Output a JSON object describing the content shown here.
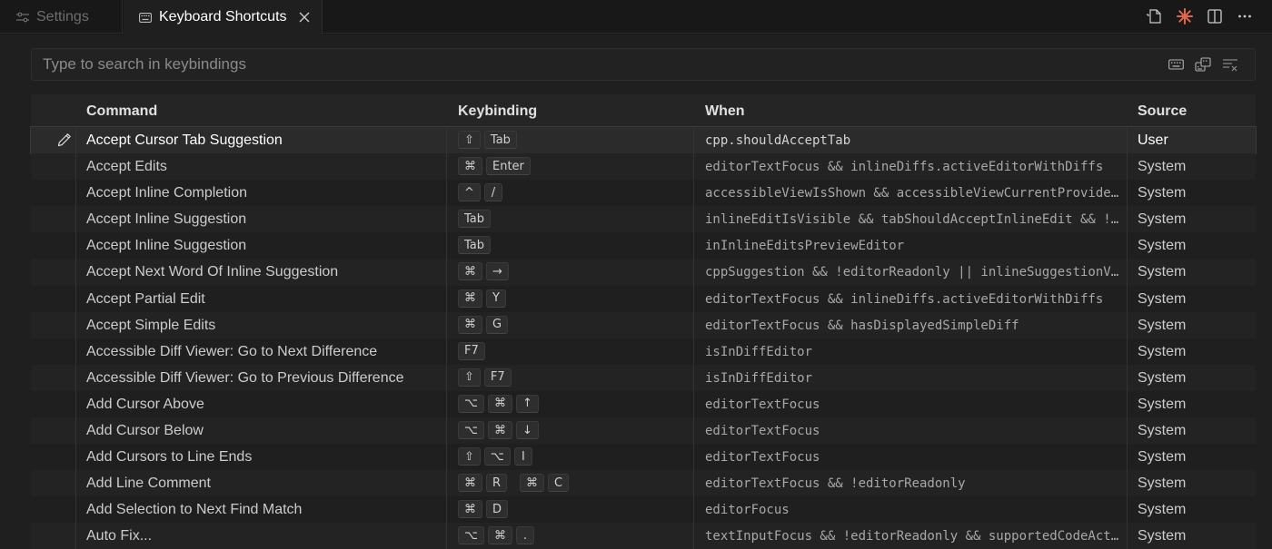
{
  "tabs": {
    "settings": "Settings",
    "keyboard_shortcuts": "Keyboard Shortcuts"
  },
  "tab_actions": [
    "open-keybindings-json-icon",
    "cursor-spark-icon",
    "split-editor-icon",
    "more-actions-icon"
  ],
  "search": {
    "placeholder": "Type to search in keybindings",
    "value": "",
    "icons": [
      "record-keys-icon",
      "sort-by-precedence-icon",
      "clear-filter-icon"
    ]
  },
  "columns": {
    "command": "Command",
    "keybinding": "Keybinding",
    "when": "When",
    "source": "Source"
  },
  "rows": [
    {
      "command": "Accept Cursor Tab Suggestion",
      "keys": [
        [
          "⇧",
          "Tab"
        ]
      ],
      "when": "cpp.shouldAcceptTab",
      "source": "User",
      "selected": true
    },
    {
      "command": "Accept Edits",
      "keys": [
        [
          "⌘",
          "Enter"
        ]
      ],
      "when": "editorTextFocus && inlineDiffs.activeEditorWithDiffs",
      "source": "System"
    },
    {
      "command": "Accept Inline Completion",
      "keys": [
        [
          "^",
          "/"
        ]
      ],
      "when": "accessibleViewIsShown && accessibleViewCurrentProvide…",
      "source": "System"
    },
    {
      "command": "Accept Inline Suggestion",
      "keys": [
        [
          "Tab"
        ]
      ],
      "when": "inlineEditIsVisible && tabShouldAcceptInlineEdit && !…",
      "source": "System"
    },
    {
      "command": "Accept Inline Suggestion",
      "keys": [
        [
          "Tab"
        ]
      ],
      "when": "inInlineEditsPreviewEditor",
      "source": "System"
    },
    {
      "command": "Accept Next Word Of Inline Suggestion",
      "keys": [
        [
          "⌘",
          "→"
        ]
      ],
      "when": "cppSuggestion && !editorReadonly || inlineSuggestionV…",
      "source": "System"
    },
    {
      "command": "Accept Partial Edit",
      "keys": [
        [
          "⌘",
          "Y"
        ]
      ],
      "when": "editorTextFocus && inlineDiffs.activeEditorWithDiffs",
      "source": "System"
    },
    {
      "command": "Accept Simple Edits",
      "keys": [
        [
          "⌘",
          "G"
        ]
      ],
      "when": "editorTextFocus && hasDisplayedSimpleDiff",
      "source": "System"
    },
    {
      "command": "Accessible Diff Viewer: Go to Next Difference",
      "keys": [
        [
          "F7"
        ]
      ],
      "when": "isInDiffEditor",
      "source": "System"
    },
    {
      "command": "Accessible Diff Viewer: Go to Previous Difference",
      "keys": [
        [
          "⇧",
          "F7"
        ]
      ],
      "when": "isInDiffEditor",
      "source": "System"
    },
    {
      "command": "Add Cursor Above",
      "keys": [
        [
          "⌥",
          "⌘",
          "↑"
        ]
      ],
      "when": "editorTextFocus",
      "source": "System"
    },
    {
      "command": "Add Cursor Below",
      "keys": [
        [
          "⌥",
          "⌘",
          "↓"
        ]
      ],
      "when": "editorTextFocus",
      "source": "System"
    },
    {
      "command": "Add Cursors to Line Ends",
      "keys": [
        [
          "⇧",
          "⌥",
          "I"
        ]
      ],
      "when": "editorTextFocus",
      "source": "System"
    },
    {
      "command": "Add Line Comment",
      "keys": [
        [
          "⌘",
          "R"
        ],
        [
          "⌘",
          "C"
        ]
      ],
      "when": "editorTextFocus && !editorReadonly",
      "source": "System"
    },
    {
      "command": "Add Selection to Next Find Match",
      "keys": [
        [
          "⌘",
          "D"
        ]
      ],
      "when": "editorFocus",
      "source": "System"
    },
    {
      "command": "Auto Fix...",
      "keys": [
        [
          "⌥",
          "⌘",
          "."
        ]
      ],
      "when": "textInputFocus && !editorReadonly && supportedCodeAct…",
      "source": "System"
    }
  ]
}
